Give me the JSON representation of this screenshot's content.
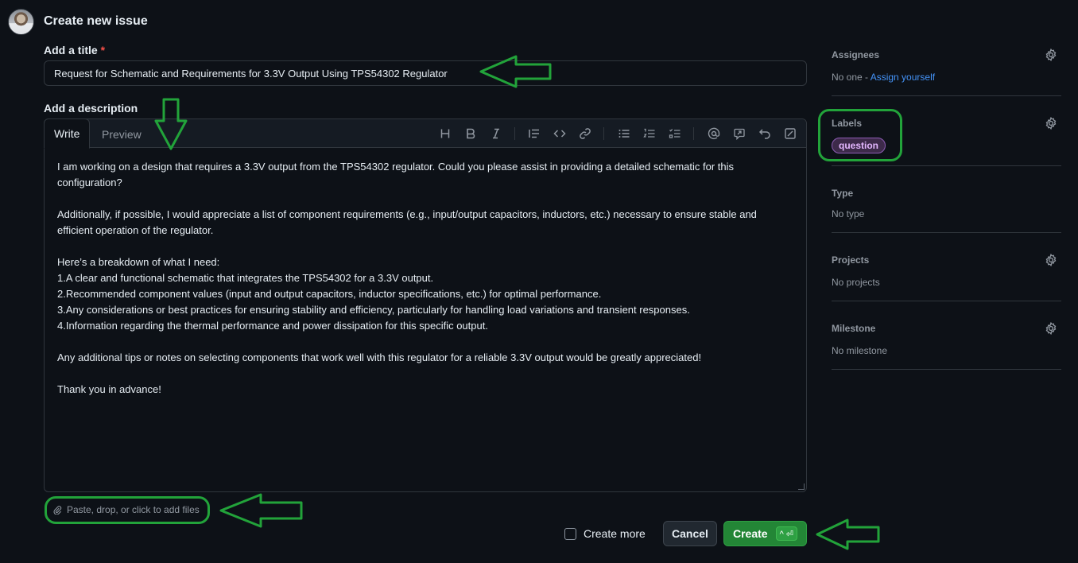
{
  "header": {
    "title": "Create new issue"
  },
  "title_field": {
    "label": "Add a title",
    "required_mark": "*",
    "value": "Request for Schematic and Requirements for 3.3V Output Using TPS54302 Regulator"
  },
  "description": {
    "label": "Add a description",
    "tabs": [
      "Write",
      "Preview"
    ],
    "toolbar_icons": [
      "heading-icon",
      "bold-icon",
      "italic-icon",
      "quote-icon",
      "code-icon",
      "link-icon",
      "unordered-list-icon",
      "ordered-list-icon",
      "task-list-icon",
      "mention-icon",
      "reference-icon",
      "undo-icon",
      "fullscreen-icon"
    ],
    "paragraphs": [
      "I am working on a design that requires a 3.3V output from the TPS54302 regulator. Could you please assist in providing a detailed schematic for this configuration?",
      "",
      "Additionally, if possible, I would appreciate a list of component requirements (e.g., input/output capacitors, inductors, etc.) necessary to ensure stable and efficient operation of the regulator.",
      "",
      "Here’s a breakdown of what I need:",
      "1.A clear and functional schematic that integrates the TPS54302 for a 3.3V output.",
      "2.Recommended component values (input and output capacitors, inductor specifications, etc.) for optimal performance.",
      "3.Any considerations or best practices for ensuring stability and efficiency, particularly for handling load variations and transient responses.",
      "4.Information regarding the thermal performance and power dissipation for this specific output.",
      "",
      "Any additional tips or notes on selecting components that work well with this regulator for a reliable 3.3V output would be greatly appreciated!",
      "",
      "Thank you in advance!"
    ],
    "attach_text": "Paste, drop, or click to add files"
  },
  "footer": {
    "create_more_label": "Create more",
    "create_more_checked": false,
    "cancel_label": "Cancel",
    "create_label": "Create",
    "create_shortcut": "^ ⏎"
  },
  "sidebar": {
    "assignees": {
      "title": "Assignees",
      "value_prefix": "No one - ",
      "assign_link": "Assign yourself"
    },
    "labels": {
      "title": "Labels",
      "items": [
        "question"
      ]
    },
    "type": {
      "title": "Type",
      "value": "No type"
    },
    "projects": {
      "title": "Projects",
      "value": "No projects"
    },
    "milestone": {
      "title": "Milestone",
      "value": "No milestone"
    }
  },
  "colors": {
    "background": "#0d1117",
    "primary_button": "#238636",
    "link": "#4493f8",
    "annotation": "#22a33a",
    "label_question": "#8e5cb5"
  }
}
